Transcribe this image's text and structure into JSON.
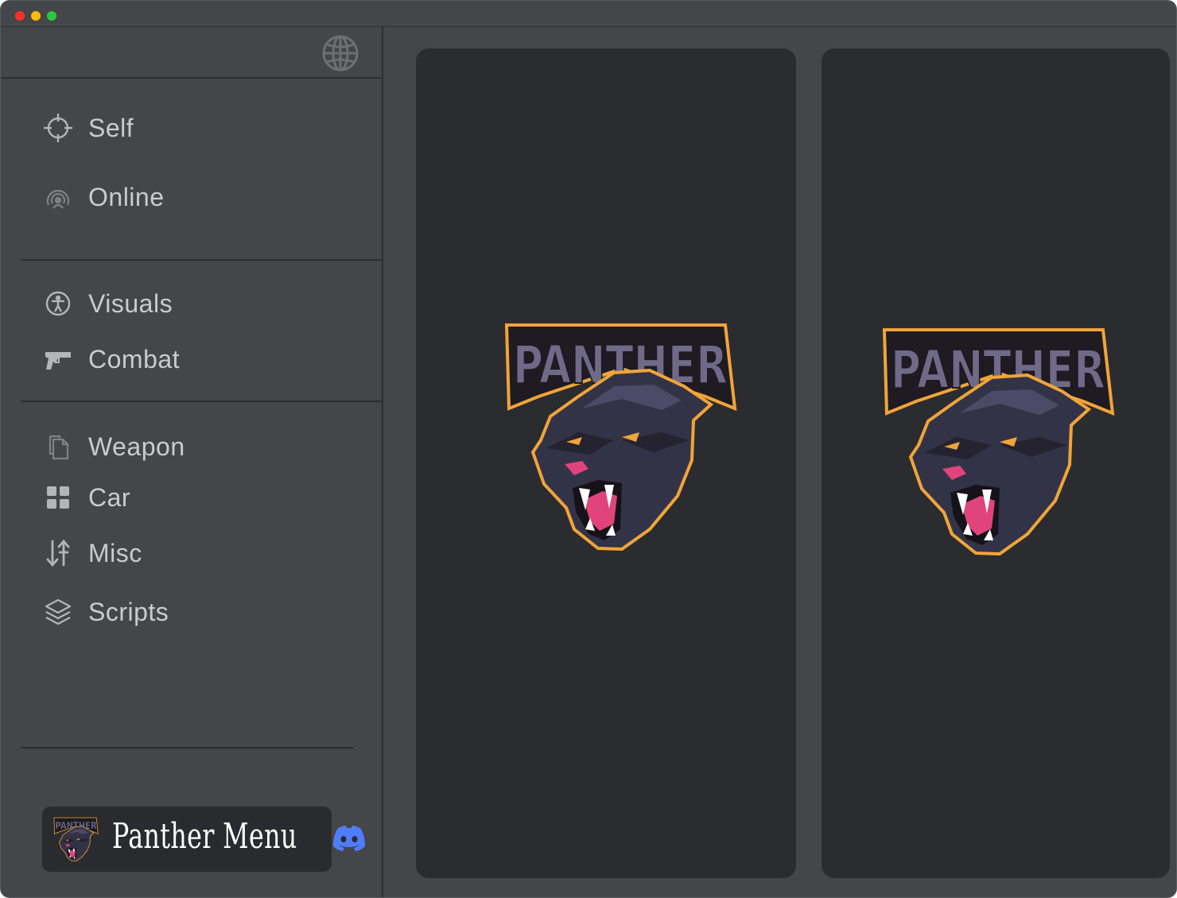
{
  "nav": {
    "group1": [
      {
        "label": "Self",
        "icon": "crosshair-icon"
      },
      {
        "label": "Online",
        "icon": "broadcast-user-icon"
      }
    ],
    "group2": [
      {
        "label": "Visuals",
        "icon": "accessibility-icon"
      },
      {
        "label": "Combat",
        "icon": "pistol-icon"
      }
    ],
    "group3": [
      {
        "label": "Weapon",
        "icon": "copy-icon"
      },
      {
        "label": "Car",
        "icon": "grid-icon"
      },
      {
        "label": "Misc",
        "icon": "sort-arrows-icon"
      },
      {
        "label": "Scripts",
        "icon": "layers-icon"
      }
    ]
  },
  "brand": {
    "name": "Panther Menu",
    "logo_text": "PANTHER"
  },
  "panels": {
    "left_logo_text": "PANTHER",
    "right_logo_text": "PANTHER"
  },
  "colors": {
    "window_bg": "#454649",
    "panel_bg": "#2b2c2f",
    "accent_orange": "#f0a43a",
    "discord_blue": "#4f7dff"
  }
}
